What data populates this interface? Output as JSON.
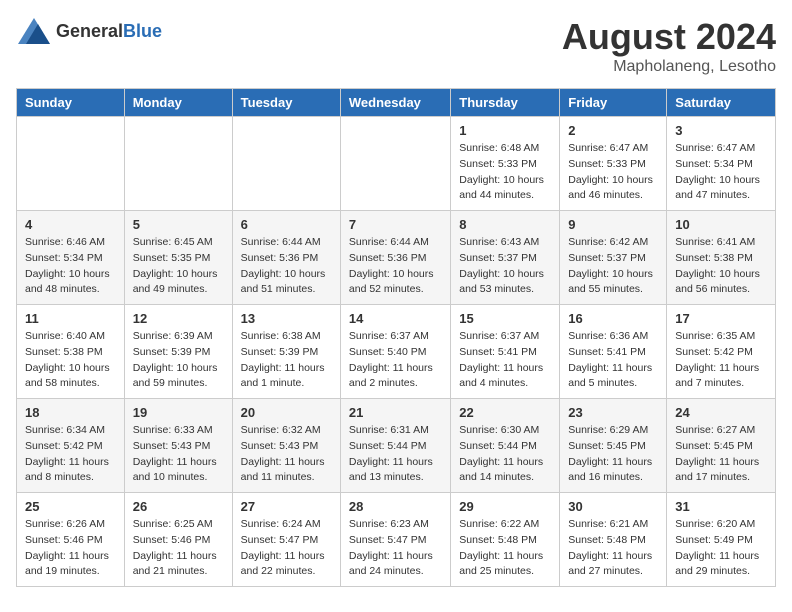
{
  "header": {
    "logo_general": "General",
    "logo_blue": "Blue",
    "month_year": "August 2024",
    "location": "Mapholaneng, Lesotho"
  },
  "weekdays": [
    "Sunday",
    "Monday",
    "Tuesday",
    "Wednesday",
    "Thursday",
    "Friday",
    "Saturday"
  ],
  "weeks": [
    [
      {
        "day": "",
        "info": ""
      },
      {
        "day": "",
        "info": ""
      },
      {
        "day": "",
        "info": ""
      },
      {
        "day": "",
        "info": ""
      },
      {
        "day": "1",
        "info": "Sunrise: 6:48 AM\nSunset: 5:33 PM\nDaylight: 10 hours\nand 44 minutes."
      },
      {
        "day": "2",
        "info": "Sunrise: 6:47 AM\nSunset: 5:33 PM\nDaylight: 10 hours\nand 46 minutes."
      },
      {
        "day": "3",
        "info": "Sunrise: 6:47 AM\nSunset: 5:34 PM\nDaylight: 10 hours\nand 47 minutes."
      }
    ],
    [
      {
        "day": "4",
        "info": "Sunrise: 6:46 AM\nSunset: 5:34 PM\nDaylight: 10 hours\nand 48 minutes."
      },
      {
        "day": "5",
        "info": "Sunrise: 6:45 AM\nSunset: 5:35 PM\nDaylight: 10 hours\nand 49 minutes."
      },
      {
        "day": "6",
        "info": "Sunrise: 6:44 AM\nSunset: 5:36 PM\nDaylight: 10 hours\nand 51 minutes."
      },
      {
        "day": "7",
        "info": "Sunrise: 6:44 AM\nSunset: 5:36 PM\nDaylight: 10 hours\nand 52 minutes."
      },
      {
        "day": "8",
        "info": "Sunrise: 6:43 AM\nSunset: 5:37 PM\nDaylight: 10 hours\nand 53 minutes."
      },
      {
        "day": "9",
        "info": "Sunrise: 6:42 AM\nSunset: 5:37 PM\nDaylight: 10 hours\nand 55 minutes."
      },
      {
        "day": "10",
        "info": "Sunrise: 6:41 AM\nSunset: 5:38 PM\nDaylight: 10 hours\nand 56 minutes."
      }
    ],
    [
      {
        "day": "11",
        "info": "Sunrise: 6:40 AM\nSunset: 5:38 PM\nDaylight: 10 hours\nand 58 minutes."
      },
      {
        "day": "12",
        "info": "Sunrise: 6:39 AM\nSunset: 5:39 PM\nDaylight: 10 hours\nand 59 minutes."
      },
      {
        "day": "13",
        "info": "Sunrise: 6:38 AM\nSunset: 5:39 PM\nDaylight: 11 hours\nand 1 minute."
      },
      {
        "day": "14",
        "info": "Sunrise: 6:37 AM\nSunset: 5:40 PM\nDaylight: 11 hours\nand 2 minutes."
      },
      {
        "day": "15",
        "info": "Sunrise: 6:37 AM\nSunset: 5:41 PM\nDaylight: 11 hours\nand 4 minutes."
      },
      {
        "day": "16",
        "info": "Sunrise: 6:36 AM\nSunset: 5:41 PM\nDaylight: 11 hours\nand 5 minutes."
      },
      {
        "day": "17",
        "info": "Sunrise: 6:35 AM\nSunset: 5:42 PM\nDaylight: 11 hours\nand 7 minutes."
      }
    ],
    [
      {
        "day": "18",
        "info": "Sunrise: 6:34 AM\nSunset: 5:42 PM\nDaylight: 11 hours\nand 8 minutes."
      },
      {
        "day": "19",
        "info": "Sunrise: 6:33 AM\nSunset: 5:43 PM\nDaylight: 11 hours\nand 10 minutes."
      },
      {
        "day": "20",
        "info": "Sunrise: 6:32 AM\nSunset: 5:43 PM\nDaylight: 11 hours\nand 11 minutes."
      },
      {
        "day": "21",
        "info": "Sunrise: 6:31 AM\nSunset: 5:44 PM\nDaylight: 11 hours\nand 13 minutes."
      },
      {
        "day": "22",
        "info": "Sunrise: 6:30 AM\nSunset: 5:44 PM\nDaylight: 11 hours\nand 14 minutes."
      },
      {
        "day": "23",
        "info": "Sunrise: 6:29 AM\nSunset: 5:45 PM\nDaylight: 11 hours\nand 16 minutes."
      },
      {
        "day": "24",
        "info": "Sunrise: 6:27 AM\nSunset: 5:45 PM\nDaylight: 11 hours\nand 17 minutes."
      }
    ],
    [
      {
        "day": "25",
        "info": "Sunrise: 6:26 AM\nSunset: 5:46 PM\nDaylight: 11 hours\nand 19 minutes."
      },
      {
        "day": "26",
        "info": "Sunrise: 6:25 AM\nSunset: 5:46 PM\nDaylight: 11 hours\nand 21 minutes."
      },
      {
        "day": "27",
        "info": "Sunrise: 6:24 AM\nSunset: 5:47 PM\nDaylight: 11 hours\nand 22 minutes."
      },
      {
        "day": "28",
        "info": "Sunrise: 6:23 AM\nSunset: 5:47 PM\nDaylight: 11 hours\nand 24 minutes."
      },
      {
        "day": "29",
        "info": "Sunrise: 6:22 AM\nSunset: 5:48 PM\nDaylight: 11 hours\nand 25 minutes."
      },
      {
        "day": "30",
        "info": "Sunrise: 6:21 AM\nSunset: 5:48 PM\nDaylight: 11 hours\nand 27 minutes."
      },
      {
        "day": "31",
        "info": "Sunrise: 6:20 AM\nSunset: 5:49 PM\nDaylight: 11 hours\nand 29 minutes."
      }
    ]
  ]
}
